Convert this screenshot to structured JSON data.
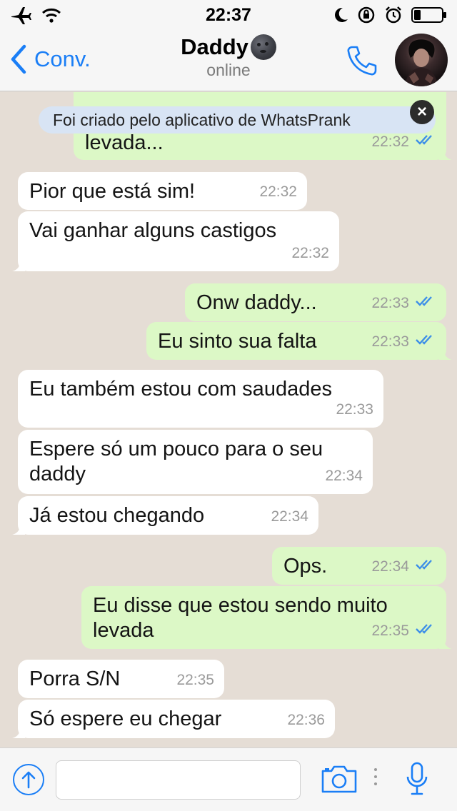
{
  "status_bar": {
    "time": "22:37",
    "left_icons": [
      "airplane-icon",
      "wifi-icon"
    ],
    "right_icons": [
      "moon-icon",
      "orientation-lock-icon",
      "alarm-icon",
      "battery-icon"
    ]
  },
  "header": {
    "back_label": "Conv.",
    "title": "Daddy",
    "title_emoji": "new-moon-face-emoji",
    "subtitle": "online",
    "call_icon": "phone-icon",
    "avatar": "contact-avatar"
  },
  "banner": {
    "text": "Foi criado pelo aplicativo de WhatsPrank",
    "close_icon": "close-icon"
  },
  "messages": [
    {
      "direction": "out",
      "text": "levada...",
      "time": "22:32",
      "read": true
    },
    {
      "direction": "in",
      "text": "Pior que está sim!",
      "time": "22:32"
    },
    {
      "direction": "in",
      "text": "Vai ganhar alguns castigos",
      "time": "22:32"
    },
    {
      "direction": "out",
      "text": "Onw daddy...",
      "time": "22:33",
      "read": true
    },
    {
      "direction": "out",
      "text": "Eu sinto sua falta",
      "time": "22:33",
      "read": true
    },
    {
      "direction": "in",
      "text": "Eu também estou com saudades",
      "time": "22:33"
    },
    {
      "direction": "in",
      "text": "Espere só um pouco para o seu\ndaddy",
      "time": "22:34"
    },
    {
      "direction": "in",
      "text": "Já estou chegando",
      "time": "22:34"
    },
    {
      "direction": "out",
      "text": "Ops.",
      "time": "22:34",
      "read": true
    },
    {
      "direction": "out",
      "text": "Eu disse que estou sendo muito\nlevada",
      "time": "22:35",
      "read": true
    },
    {
      "direction": "in",
      "text": "Porra S/N",
      "time": "22:35"
    },
    {
      "direction": "in",
      "text": "Só espere eu chegar",
      "time": "22:36"
    }
  ],
  "input_bar": {
    "share_icon": "share-arrow-icon",
    "text_value": "",
    "camera_icon": "camera-icon",
    "mic_icon": "microphone-icon"
  },
  "colors": {
    "accent": "#1a7ef6",
    "outgoing_bubble": "#dcf8c6",
    "incoming_bubble": "#ffffff",
    "chat_background": "#e5ddd5",
    "read_ticks": "#3d8fe8"
  }
}
